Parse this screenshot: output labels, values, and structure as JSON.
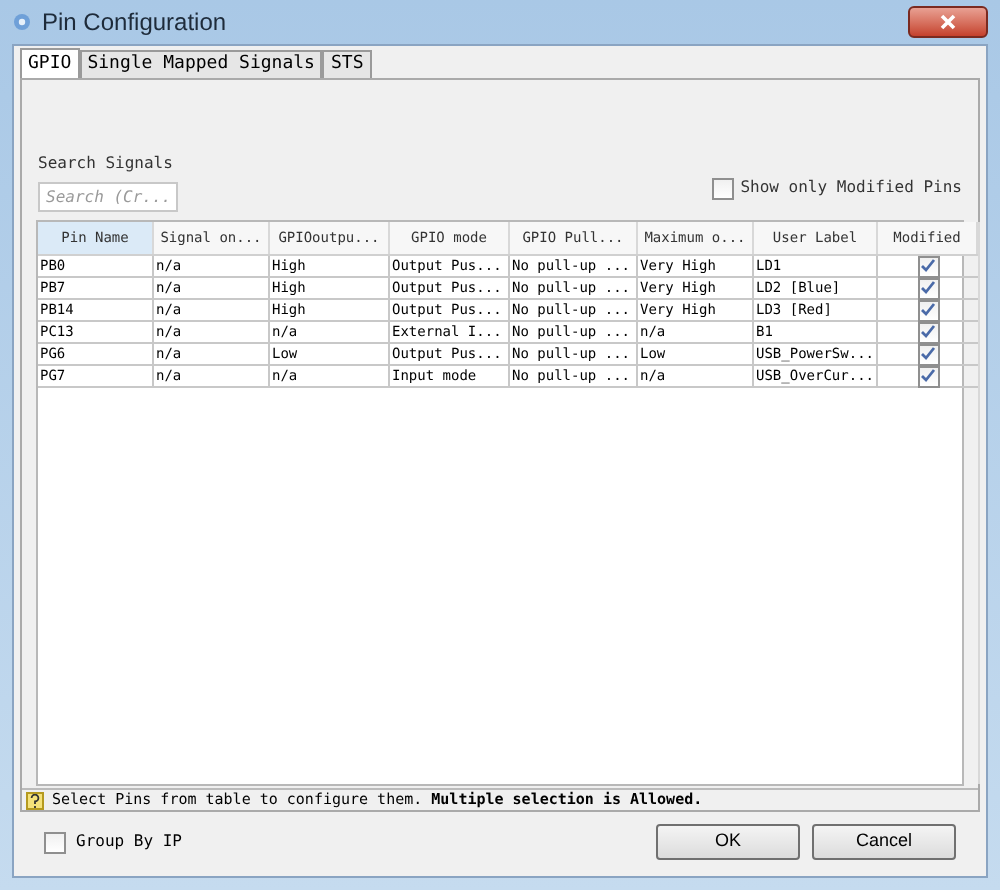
{
  "window": {
    "title": "Pin Configuration"
  },
  "tabs": [
    {
      "label": "GPIO",
      "selected": true
    },
    {
      "label": "Single Mapped Signals",
      "selected": false
    },
    {
      "label": "STS",
      "selected": false
    }
  ],
  "search": {
    "label": "Search Signals",
    "placeholder": "Search (Cr..."
  },
  "show_only_modified": {
    "label": "Show only Modified Pins",
    "checked": false
  },
  "table": {
    "columns": [
      "Pin Name",
      "Signal on...",
      "GPIOoutpu...",
      "GPIO mode",
      "GPIO Pull...",
      "Maximum o...",
      "User Label",
      "Modified"
    ],
    "rows": [
      {
        "cells": [
          "PB0",
          "n/a",
          "High",
          "Output Pus...",
          "No pull-up ...",
          "Very High",
          "LD1"
        ],
        "modified": true
      },
      {
        "cells": [
          "PB7",
          "n/a",
          "High",
          "Output Pus...",
          "No pull-up ...",
          "Very High",
          "LD2 [Blue]"
        ],
        "modified": true
      },
      {
        "cells": [
          "PB14",
          "n/a",
          "High",
          "Output Pus...",
          "No pull-up ...",
          "Very High",
          "LD3 [Red]"
        ],
        "modified": true
      },
      {
        "cells": [
          "PC13",
          "n/a",
          "n/a",
          "External I...",
          "No pull-up ...",
          "n/a",
          "B1"
        ],
        "modified": true
      },
      {
        "cells": [
          "PG6",
          "n/a",
          "Low",
          "Output Pus...",
          "No pull-up ...",
          "Low",
          "USB_PowerSw..."
        ],
        "modified": true
      },
      {
        "cells": [
          "PG7",
          "n/a",
          "n/a",
          "Input mode",
          "No pull-up ...",
          "n/a",
          "USB_OverCur..."
        ],
        "modified": true
      }
    ]
  },
  "hint": "Select Pins from table to configure them. **Multiple selection is Allowed.**",
  "group_by_ip": {
    "label": "Group By IP",
    "checked": false
  },
  "buttons": [
    "OK",
    "Cancel"
  ]
}
